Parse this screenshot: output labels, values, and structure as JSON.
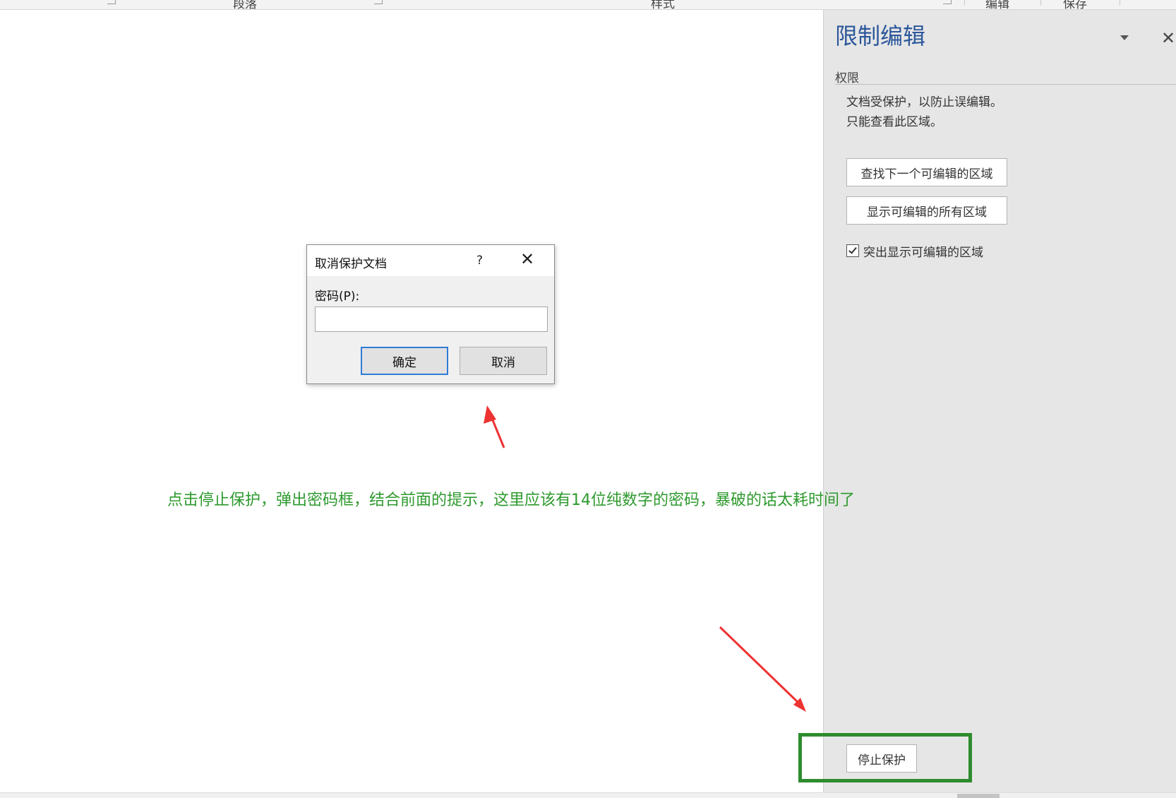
{
  "ribbon": {
    "groups": [
      "段落",
      "样式",
      "编辑",
      "保存"
    ]
  },
  "pane": {
    "title": "限制编辑",
    "section": "权限",
    "message_line1": "文档受保护，以防止误编辑。",
    "message_line2": "只能查看此区域。",
    "find_next_label": "查找下一个可编辑的区域",
    "show_all_label": "显示可编辑的所有区域",
    "highlight_label": "突出显示可编辑的区域",
    "highlight_checked": true,
    "stop_protection_label": "停止保护",
    "close_glyph": "✕"
  },
  "dialog": {
    "title": "取消保护文档",
    "help_glyph": "?",
    "close_glyph": "✕",
    "password_label": "密码(P):",
    "password_value": "",
    "ok_label": "确定",
    "cancel_label": "取消"
  },
  "annotation": {
    "text": "点击停止保护，弹出密码框，结合前面的提示，这里应该有14位纯数字的密码，暴破的话太耗时间了",
    "color": "#2e9a2e",
    "arrow_color": "#ee3333",
    "highlight_box_color": "#2e8b2e"
  }
}
